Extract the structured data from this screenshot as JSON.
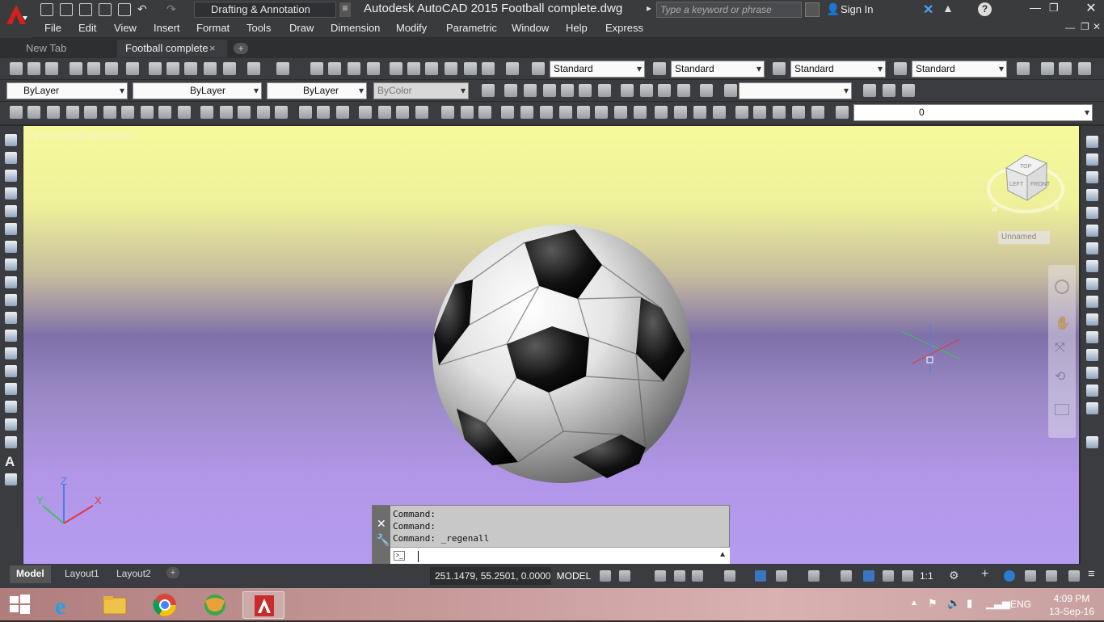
{
  "app": {
    "workspace": "Drafting & Annotation",
    "title": "Autodesk AutoCAD 2015    Football complete.dwg",
    "search_placeholder": "Type a keyword or phrase",
    "signin": "Sign In"
  },
  "menu": [
    "File",
    "Edit",
    "View",
    "Insert",
    "Format",
    "Tools",
    "Draw",
    "Dimension",
    "Modify",
    "Parametric",
    "Window",
    "Help",
    "Express"
  ],
  "tabs": {
    "new_tab": "New Tab",
    "active": "Football complete",
    "close": "×",
    "add": "+"
  },
  "styles": {
    "text_style": "Standard",
    "dim_style": "Standard",
    "table_style": "Standard",
    "mleader_style": "Standard"
  },
  "properties": {
    "layer_color": "ByLayer",
    "linetype": "ByLayer",
    "lineweight": "ByLayer",
    "plot_style": "ByColor",
    "layer_name": "0"
  },
  "viewport": {
    "label": "[−][SW Isometric][Realistic]",
    "viewcube_label": "Unnamed",
    "cube_top": "TOP",
    "cube_left": "LEFT",
    "cube_front": "FRONT",
    "compass_w": "W",
    "compass_s": "S"
  },
  "command": {
    "lines": [
      "Command:",
      "Command:",
      "Command: _regenall"
    ]
  },
  "layouts": [
    "Model",
    "Layout1",
    "Layout2"
  ],
  "status": {
    "coords": "251.1479, 55.2501, 0.0000",
    "model": "MODEL",
    "scale": "1:1"
  },
  "taskbar": {
    "lang": "ENG",
    "time": "4:09 PM",
    "date": "13-Sep-16"
  }
}
